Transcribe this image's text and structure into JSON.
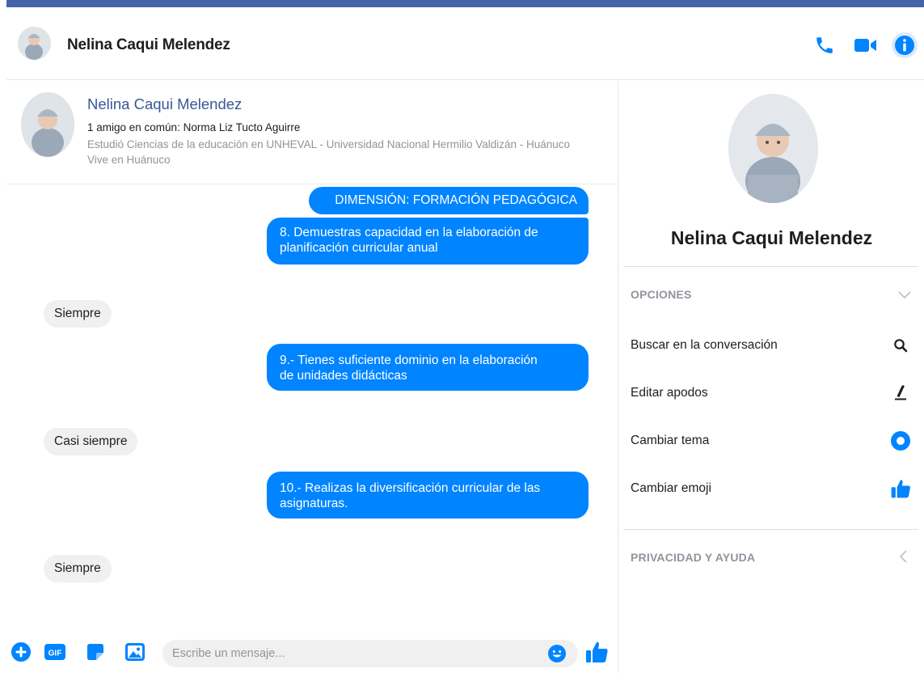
{
  "colors": {
    "accent": "#0084ff",
    "topbar": "#4563a9",
    "link": "#365899",
    "muted": "#90949c",
    "bubble_in": "#f1f0f0"
  },
  "header": {
    "title": "Nelina Caqui Melendez",
    "icons": [
      "phone-icon",
      "video-camera-icon",
      "info-icon"
    ]
  },
  "profile_card": {
    "name": "Nelina Caqui Melendez",
    "mutual": "1 amigo en común: Norma Liz Tucto Aguirre",
    "study": "Estudió Ciencias de la educación en UNHEVAL - Universidad Nacional Hermilio Valdizán - Huánuco",
    "lives": "Vive en Huánuco"
  },
  "messages": [
    {
      "dir": "out",
      "text": "DIMENSIÓN:  FORMACIÓN  PEDAGÓGICA"
    },
    {
      "dir": "out",
      "line1": "8.  Demuestras capacidad en la elaboración de",
      "line2": "planificación  curricular  anual"
    },
    {
      "dir": "in",
      "text": "Siempre"
    },
    {
      "dir": "out",
      "line1": "9.- Tienes  suficiente dominio  en la elaboración",
      "line2": "de unidades  didácticas"
    },
    {
      "dir": "in",
      "text": "Casi siempre"
    },
    {
      "dir": "out",
      "line1": "10.- Realizas   la diversificación  curricular   de las",
      "line2": "asignaturas."
    },
    {
      "dir": "in",
      "text": "Siempre"
    }
  ],
  "composer": {
    "placeholder": "Escribe un mensaje...",
    "icons": [
      "plus-icon",
      "gif-icon",
      "sticker-icon",
      "image-icon",
      "emoji-icon",
      "like-icon"
    ]
  },
  "sidebar": {
    "name": "Nelina Caqui Melendez",
    "options_title": "OPCIONES",
    "options": [
      {
        "label": "Buscar en la conversación",
        "icon": "search-icon"
      },
      {
        "label": "Editar apodos",
        "icon": "pencil-icon"
      },
      {
        "label": "Cambiar tema",
        "icon": "theme-circle-icon"
      },
      {
        "label": "Cambiar emoji",
        "icon": "thumbs-up-icon"
      }
    ],
    "privacy_title": "PRIVACIDAD Y AYUDA"
  }
}
